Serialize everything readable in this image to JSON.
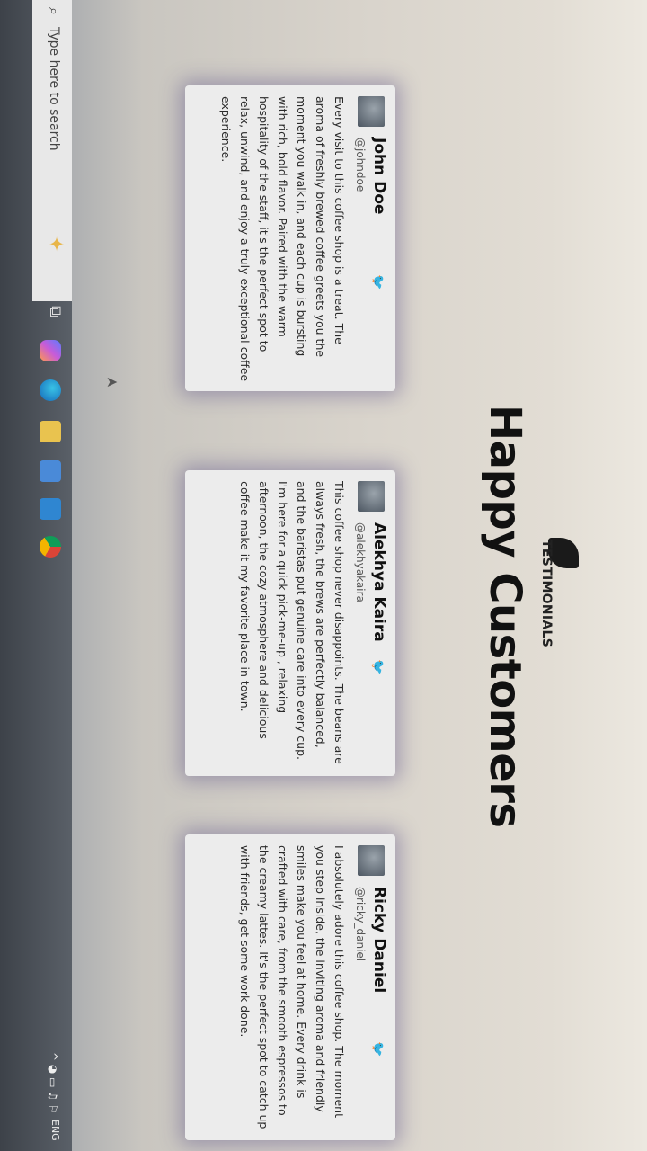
{
  "header": {
    "eyebrow": "TESTIMONIALS",
    "title": "Happy Customers"
  },
  "testimonials": [
    {
      "name": "John Doe",
      "handle": "@johndoe",
      "text": "Every visit to this coffee shop is a treat. The aroma of freshly brewed coffee greets you the moment you walk in, and each cup is bursting with rich, bold flavor. Paired with the warm hospitality of the staff, it's the perfect spot to relax, unwind, and enjoy a truly exceptional coffee experience."
    },
    {
      "name": "Alekhya Kaira",
      "handle": "@alekhyakaira",
      "text": "This coffee shop never disappoints. The beans are always fresh, the brews are perfectly balanced, and the baristas put genuine care into every cup. I'm here for a quick pick-me-up , relaxing afternoon, the cozy atmosphere and delicious coffee make it my favorite place in town."
    },
    {
      "name": "Ricky Daniel",
      "handle": "@ricky_daniel",
      "text": "I absolutely adore this coffee shop. The moment you step inside, the inviting aroma and friendly smiles make you feel at home. Every drink is crafted with care, from the smooth espressos to the creamy lattes. It's the perfect spot to catch up with friends, get some work done."
    }
  ],
  "taskbar": {
    "search_placeholder": "Type here to search",
    "tray": "^ ◕ ▭ ♫ ⚐",
    "lang": "ENG"
  },
  "icons": {
    "twitter": "twitter-icon",
    "search": "search-icon"
  }
}
